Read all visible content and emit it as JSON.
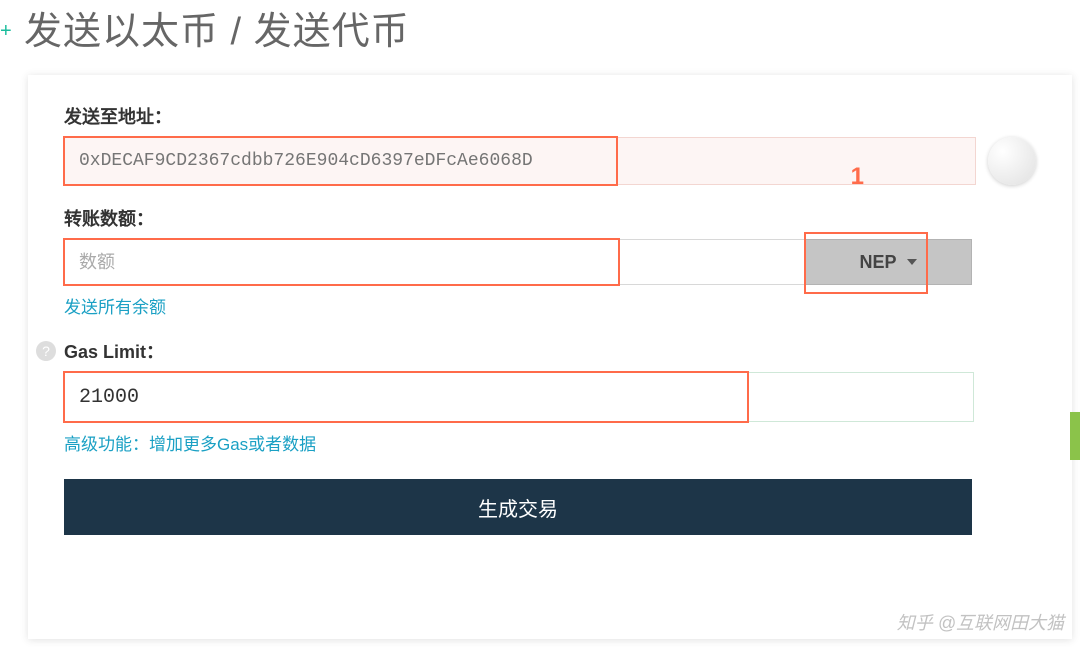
{
  "header": {
    "title": "发送以太币 / 发送代币"
  },
  "form": {
    "address": {
      "label": "发送至地址：",
      "placeholder": "0xDECAF9CD2367cdbb726E904cD6397eDFcAe6068D"
    },
    "amount": {
      "label": "转账数额：",
      "placeholder": "数额",
      "token_selected": "NEP",
      "send_all_link": "发送所有余额"
    },
    "gas": {
      "label": "Gas Limit：",
      "value": "21000",
      "advanced_link": "高级功能：增加更多Gas或者数据"
    },
    "generate_button": "生成交易"
  },
  "annotations": {
    "marker_1": "1"
  },
  "watermark": "知乎 @互联网田大猫"
}
